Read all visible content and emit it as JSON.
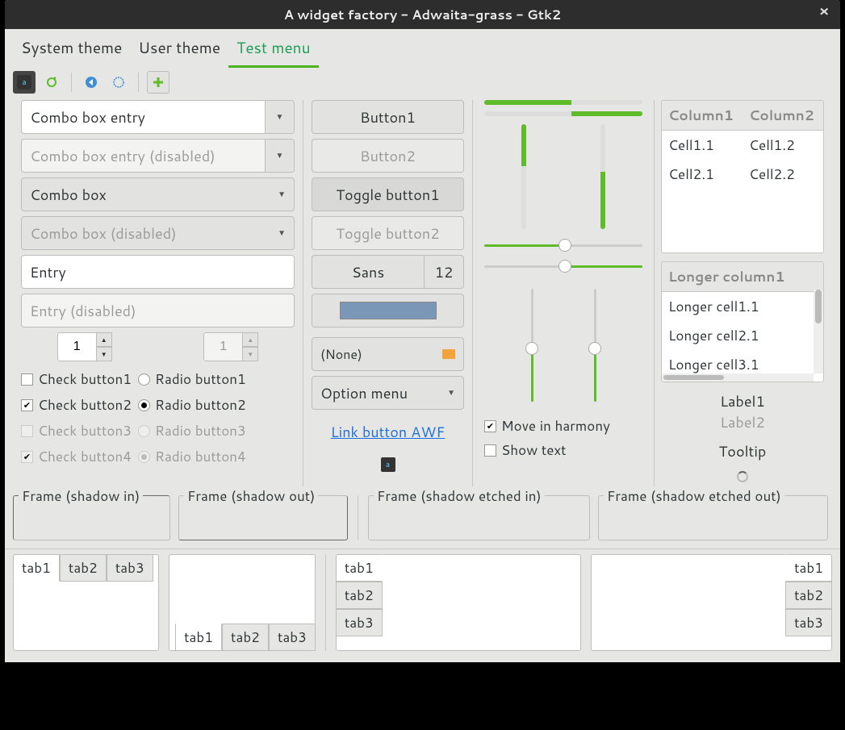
{
  "window": {
    "title": "A widget factory - Adwaita-grass - Gtk2"
  },
  "menubar": {
    "items": [
      "System theme",
      "User theme",
      "Test menu"
    ],
    "active_index": 2
  },
  "col1": {
    "combo_entry": "Combo box entry",
    "combo_entry_disabled": "Combo box entry (disabled)",
    "combo": "Combo box",
    "combo_disabled": "Combo box (disabled)",
    "entry": "Entry",
    "entry_disabled_ph": "Entry (disabled)",
    "spin1": "1",
    "spin2": "1",
    "check1": "Check button1",
    "check2": "Check button2",
    "check3": "Check button3",
    "check4": "Check button4",
    "radio1": "Radio button1",
    "radio2": "Radio button2",
    "radio3": "Radio button3",
    "radio4": "Radio button4"
  },
  "col2": {
    "button1": "Button1",
    "button2": "Button2",
    "toggle1": "Toggle button1",
    "toggle2": "Toggle button2",
    "font_name": "Sans",
    "font_size": "12",
    "file": "(None)",
    "option": "Option menu",
    "link": "Link button AWF"
  },
  "col3": {
    "harmony": "Move in harmony",
    "showtext": "Show text"
  },
  "col4": {
    "table1": {
      "headers": [
        "Column1",
        "Column2"
      ],
      "rows": [
        [
          "Cell1.1",
          "Cell1.2"
        ],
        [
          "Cell2.1",
          "Cell2.2"
        ]
      ]
    },
    "table2": {
      "header": "Longer column1",
      "rows": [
        "Longer cell1.1",
        "Longer cell2.1",
        "Longer cell3.1"
      ]
    },
    "label1": "Label1",
    "label2": "Label2",
    "tooltip": "Tooltip"
  },
  "frames": {
    "in": "Frame (shadow in)",
    "out": "Frame (shadow out)",
    "ein": "Frame (shadow etched in)",
    "eout": "Frame (shadow etched out)"
  },
  "tabs": [
    "tab1",
    "tab2",
    "tab3"
  ]
}
